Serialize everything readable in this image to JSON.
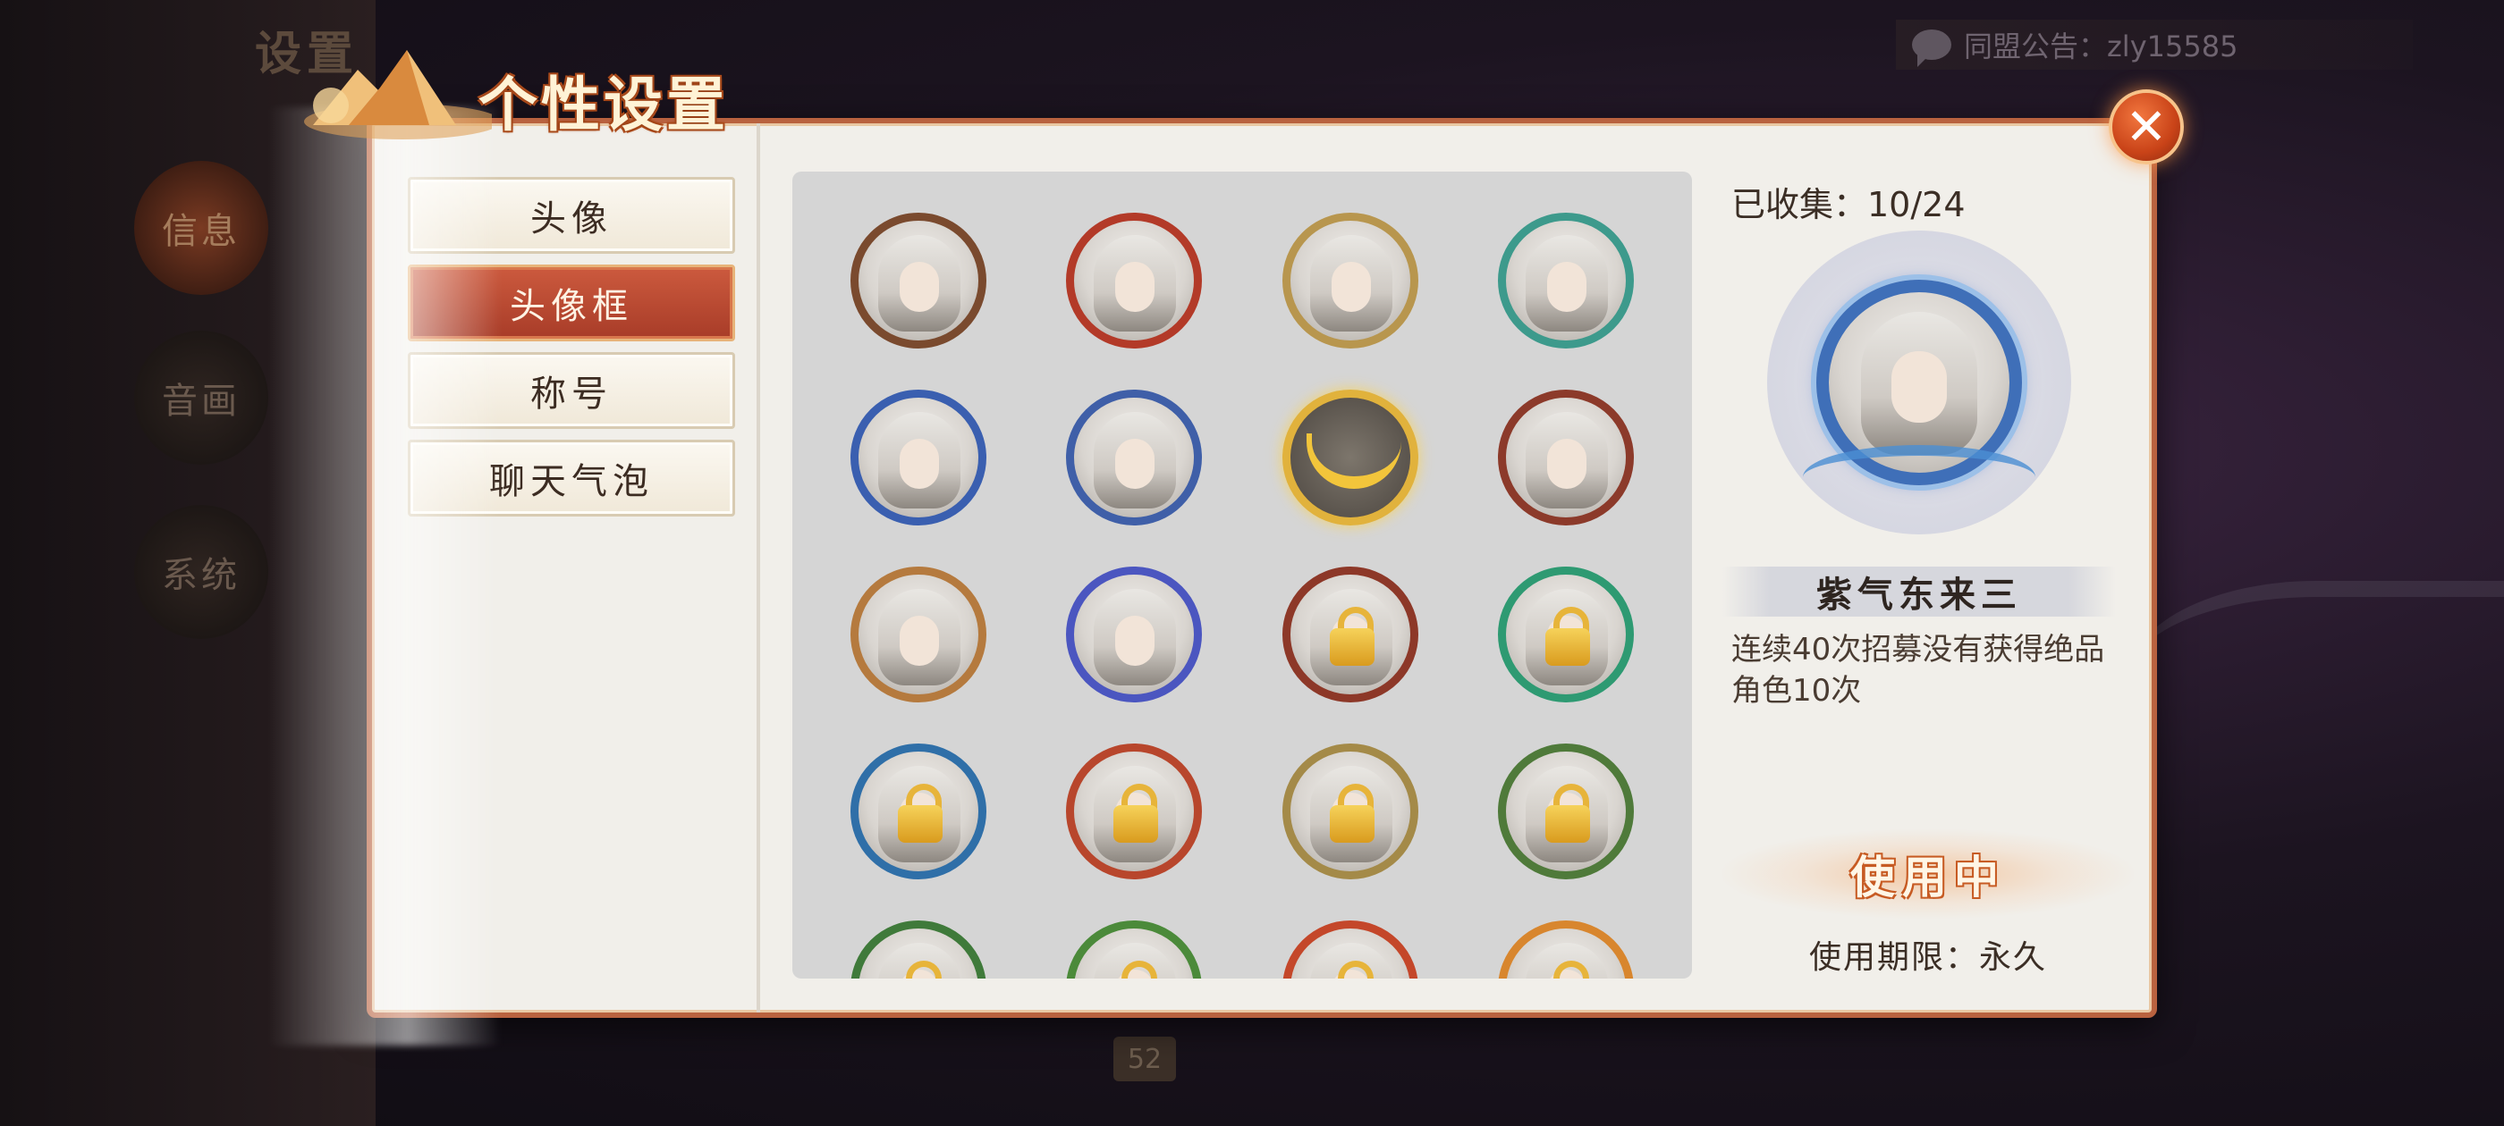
{
  "background": {
    "settings_title": "设置",
    "side_tabs": [
      "信息",
      "音画",
      "系统"
    ],
    "announcement": "同盟公告：zly15585",
    "level_badge": "52"
  },
  "dialog": {
    "title": "个性设置",
    "close_label": "✕",
    "menu": [
      {
        "label": "头像",
        "active": false
      },
      {
        "label": "头像框",
        "active": true
      },
      {
        "label": "称号",
        "active": false
      },
      {
        "label": "聊天气泡",
        "active": false
      }
    ],
    "frames": [
      {
        "color": "#7a4a2e",
        "locked": false,
        "style": "plain"
      },
      {
        "color": "#b33a28",
        "locked": false,
        "style": "plain"
      },
      {
        "color": "#b8964e",
        "locked": false,
        "style": "plain"
      },
      {
        "color": "#3d9a8c",
        "locked": false,
        "style": "plain"
      },
      {
        "color": "#3a5fb0",
        "locked": false,
        "style": "plain"
      },
      {
        "color": "#3f5fa8",
        "locked": false,
        "style": "plain"
      },
      {
        "color": "#e1b23c",
        "locked": false,
        "style": "sword"
      },
      {
        "color": "#8c3a2a",
        "locked": false,
        "style": "plain"
      },
      {
        "color": "#b57a3e",
        "locked": false,
        "style": "plain"
      },
      {
        "color": "#4b56c0",
        "locked": false,
        "style": "plain"
      },
      {
        "color": "#8d3828",
        "locked": true,
        "style": "plain"
      },
      {
        "color": "#2e9a72",
        "locked": true,
        "style": "plain"
      },
      {
        "color": "#2f6fa8",
        "locked": true,
        "style": "plain"
      },
      {
        "color": "#b8462c",
        "locked": true,
        "style": "plain"
      },
      {
        "color": "#a48a48",
        "locked": true,
        "style": "plain"
      },
      {
        "color": "#4f7a3a",
        "locked": true,
        "style": "plain"
      },
      {
        "color": "#3f7a3a",
        "locked": true,
        "style": "plain"
      },
      {
        "color": "#4b8a3a",
        "locked": true,
        "style": "plain"
      },
      {
        "color": "#c4472a",
        "locked": true,
        "style": "plain"
      },
      {
        "color": "#d8862e",
        "locked": true,
        "style": "plain"
      }
    ],
    "detail": {
      "collected": "已收集：10/24",
      "name": "紫气东来三",
      "description": "连续40次招募没有获得绝品角色10次",
      "status": "使用中",
      "validity": "使用期限：永久"
    }
  }
}
